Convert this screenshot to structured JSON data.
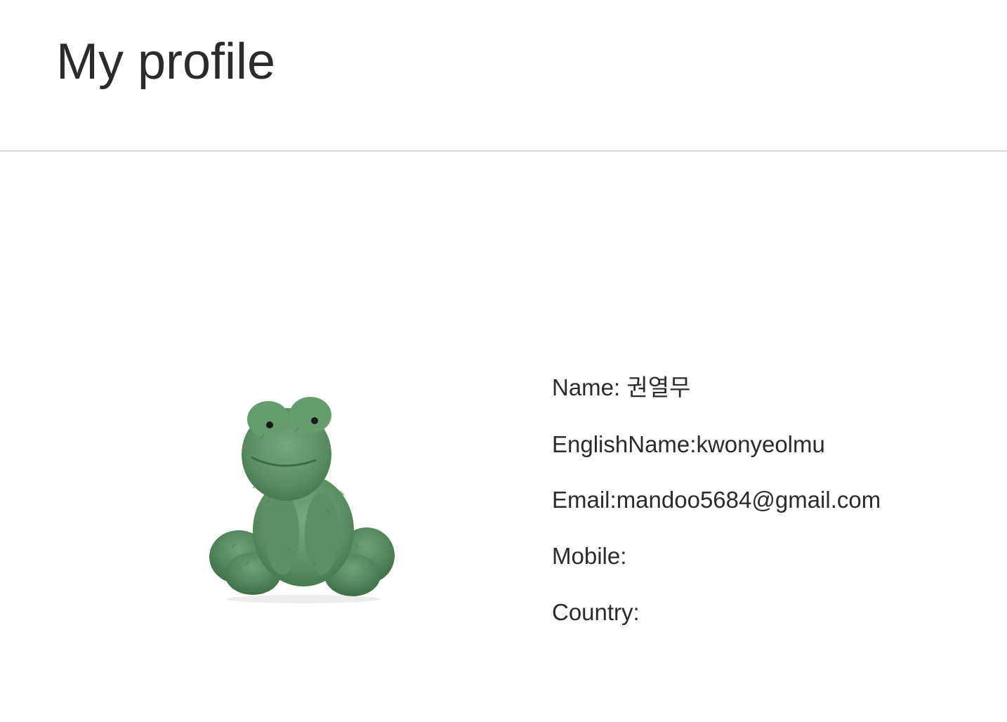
{
  "page": {
    "title": "My profile"
  },
  "profile": {
    "avatar_icon": "green-plush-frog",
    "fields": [
      {
        "label": "Name: ",
        "value": "권열무"
      },
      {
        "label": "EnglishName:",
        "value": "kwonyeolmu"
      },
      {
        "label": "Email:",
        "value": "mandoo5684@gmail.com"
      },
      {
        "label": "Mobile:",
        "value": ""
      },
      {
        "label": "Country:",
        "value": ""
      }
    ]
  },
  "colors": {
    "text": "#2b2b2b",
    "divider": "#d6d6d6",
    "frog_green": "#5e9467"
  }
}
